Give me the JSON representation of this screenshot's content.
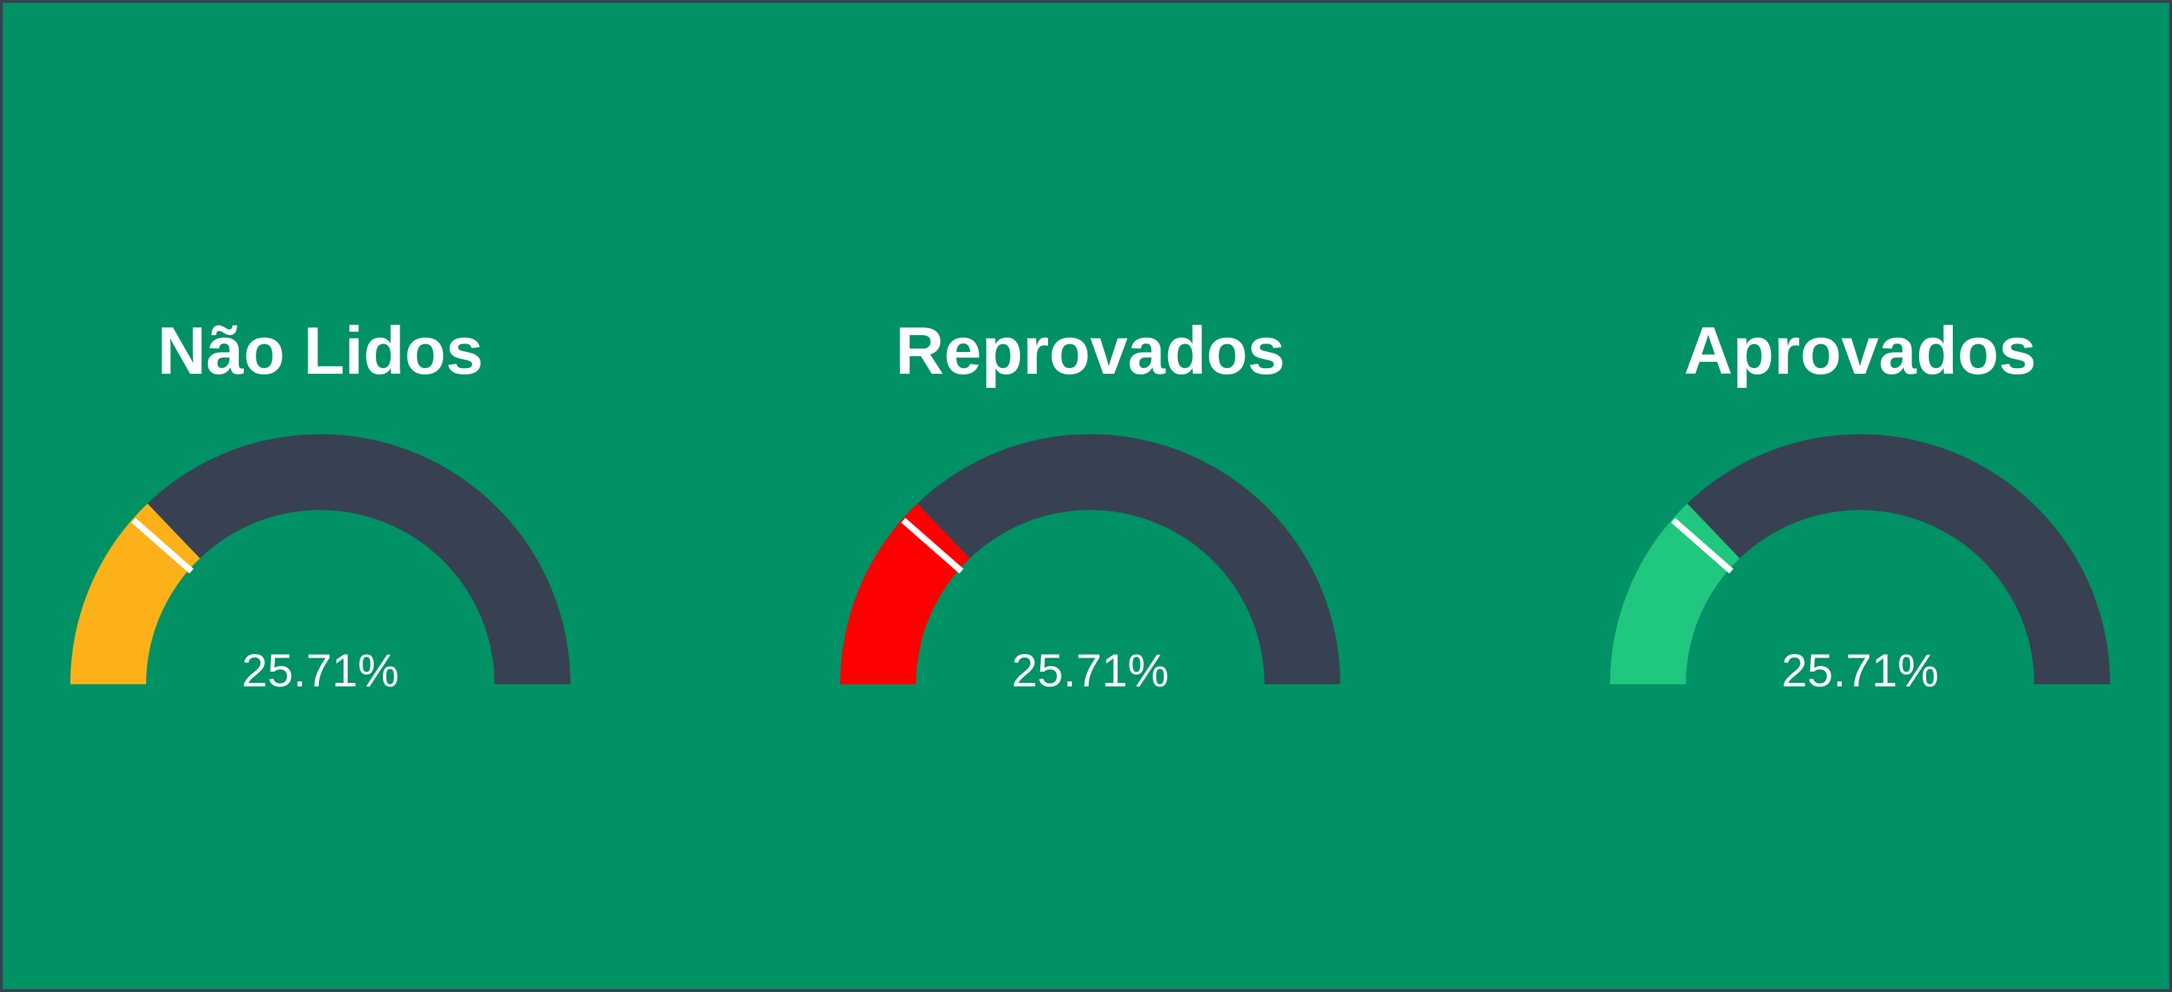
{
  "colors": {
    "background": "#009165",
    "frame": "#374151",
    "track": "#374151",
    "text": "#ffffff",
    "marker": "#ffffff"
  },
  "gauges": [
    {
      "title": "Não Lidos",
      "value_label": "25.71%",
      "percent": 25.71,
      "fill_color": "#fbb117"
    },
    {
      "title": "Reprovados",
      "value_label": "25.71%",
      "percent": 25.71,
      "fill_color": "#ff0000"
    },
    {
      "title": "Aprovados",
      "value_label": "25.71%",
      "percent": 25.71,
      "fill_color": "#1fc77f"
    }
  ]
}
